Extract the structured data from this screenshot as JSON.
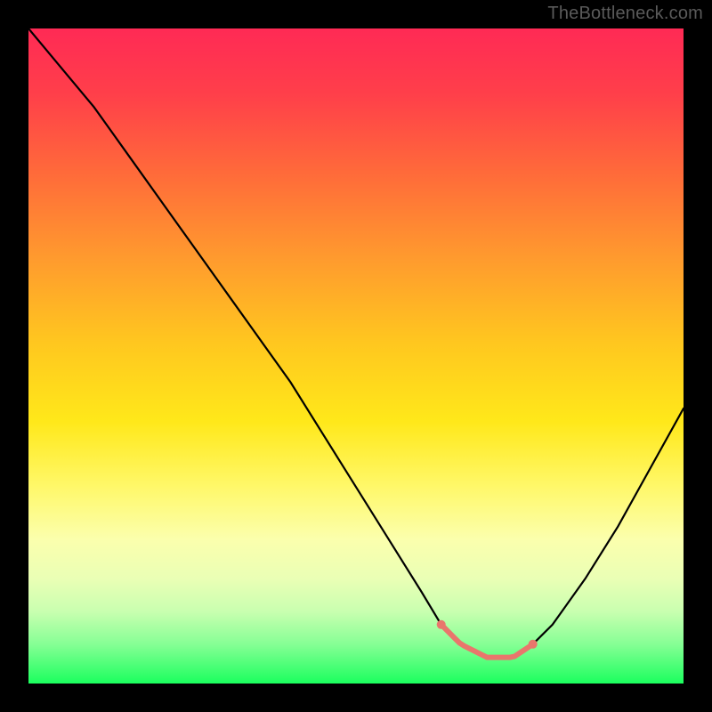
{
  "chart_data": {
    "type": "line",
    "title": "",
    "watermark": "TheBottleneck.com",
    "xlabel": "",
    "ylabel": "",
    "xlim": [
      0,
      100
    ],
    "ylim": [
      0,
      100
    ],
    "x": [
      0,
      5,
      10,
      15,
      20,
      25,
      30,
      35,
      40,
      45,
      50,
      55,
      60,
      63,
      66,
      70,
      74,
      77,
      80,
      85,
      90,
      95,
      100
    ],
    "values": [
      100,
      94,
      88,
      81,
      74,
      67,
      60,
      53,
      46,
      38,
      30,
      22,
      14,
      9,
      6,
      4,
      4,
      6,
      9,
      16,
      24,
      33,
      42
    ],
    "highlight_range_x": [
      63,
      77
    ],
    "notes": "Single black V-shaped curve over a vertical red→yellow→green gradient; the near-bottom flat segment (min bottleneck) is highlighted in salmon with endpoint dots."
  },
  "colors": {
    "curve": "#000000",
    "highlight": "#e9766c",
    "gradient_top": "#ff2a55",
    "gradient_bottom": "#1bff5e",
    "outer_background": "#000000"
  }
}
